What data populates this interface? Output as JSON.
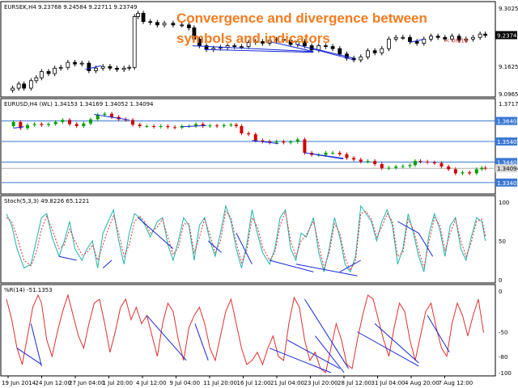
{
  "headline": "Convergence and divergence between symbols and indicators",
  "colors": {
    "background": "#ffffff",
    "frame": "#000000",
    "candle_bull": "#00a000",
    "candle_bear": "#d00000",
    "line_black": "#000000",
    "divergence_line": "#1428d8",
    "hline": "#3a78d4",
    "stoch_main": "#20b2aa",
    "stoch_signal": "#e03030",
    "wpr_line": "#e03030",
    "price_label": "#000000",
    "price_label_text": "#ffffff",
    "hline_label": "#3a78d4",
    "headline": "#f47b20",
    "countdown": "#e03030"
  },
  "panes": {
    "eursek": {
      "label": "EURSEK,H4  9.23768 9.24584 9.22711 9.23749",
      "countdown": "< 0m16",
      "current_price": "9.23749",
      "yticks": [
        "9.3025",
        "9.1625",
        "9.0965"
      ]
    },
    "eurusd": {
      "label": "EURUSD,H4 (WL) 1.34153 1.34169 1.34052 1.34094",
      "top_value": "1.37174",
      "hlines": [
        "1.36400",
        "1.35400",
        "1.34400",
        "1.34094",
        "1.33400"
      ],
      "current_price": "1.34094"
    },
    "stoch": {
      "label": "Stoch(5,3,3) 49.8226 65.1221",
      "yticks": [
        "100",
        "50",
        "0"
      ]
    },
    "wpr": {
      "label": "%R(14) -51.1353",
      "yticks": [
        "0",
        "-50",
        "-80",
        "-100"
      ]
    }
  },
  "xaxis": {
    "labels": [
      "19 Jun 2014",
      "24 Jun 12:00",
      "27 Jun 04:00",
      "1 Jul 20:00",
      "4 Jul 12:00",
      "9 Jul 04:00",
      "11 Jul 20:00",
      "16 Jul 12:00",
      "21 Jul 04:00",
      "23 Jul 20:00",
      "28 Jul 12:00",
      "31 Jul 04:00",
      "4 Aug 20:00",
      "7 Aug 12:00"
    ]
  },
  "chart_data": [
    {
      "type": "candlestick",
      "name": "EURSEK,H4",
      "ylim": [
        9.0965,
        9.3025
      ],
      "points": [
        [
          0,
          9.105
        ],
        [
          7,
          9.11
        ],
        [
          14,
          9.12
        ],
        [
          20,
          9.11
        ],
        [
          28,
          9.128
        ],
        [
          34,
          9.135
        ],
        [
          40,
          9.15
        ],
        [
          48,
          9.145
        ],
        [
          55,
          9.158
        ],
        [
          62,
          9.16
        ],
        [
          70,
          9.172
        ],
        [
          78,
          9.168
        ],
        [
          86,
          9.17
        ],
        [
          94,
          9.152
        ],
        [
          102,
          9.158
        ],
        [
          110,
          9.162
        ],
        [
          118,
          9.158
        ],
        [
          126,
          9.155
        ],
        [
          134,
          9.158
        ],
        [
          140,
          9.16
        ],
        [
          146,
          9.282
        ],
        [
          150,
          9.29
        ],
        [
          156,
          9.27
        ],
        [
          164,
          9.268
        ],
        [
          172,
          9.262
        ],
        [
          180,
          9.266
        ],
        [
          190,
          9.262
        ],
        [
          200,
          9.262
        ],
        [
          208,
          9.255
        ],
        [
          214,
          9.228
        ],
        [
          220,
          9.212
        ],
        [
          228,
          9.203
        ],
        [
          236,
          9.206
        ],
        [
          244,
          9.208
        ],
        [
          252,
          9.212
        ],
        [
          260,
          9.21
        ],
        [
          268,
          9.21
        ],
        [
          276,
          9.22
        ],
        [
          284,
          9.222
        ],
        [
          292,
          9.218
        ],
        [
          300,
          9.225
        ],
        [
          308,
          9.227
        ],
        [
          316,
          9.225
        ],
        [
          324,
          9.215
        ],
        [
          332,
          9.222
        ],
        [
          340,
          9.212
        ],
        [
          348,
          9.202
        ],
        [
          356,
          9.212
        ],
        [
          364,
          9.21
        ],
        [
          372,
          9.205
        ],
        [
          380,
          9.192
        ],
        [
          388,
          9.182
        ],
        [
          396,
          9.178
        ],
        [
          404,
          9.185
        ],
        [
          412,
          9.2
        ],
        [
          420,
          9.195
        ],
        [
          428,
          9.205
        ],
        [
          436,
          9.228
        ],
        [
          444,
          9.232
        ],
        [
          452,
          9.232
        ],
        [
          460,
          9.222
        ],
        [
          468,
          9.218
        ],
        [
          476,
          9.228
        ],
        [
          484,
          9.235
        ],
        [
          492,
          9.232
        ],
        [
          500,
          9.228
        ],
        [
          508,
          9.235
        ],
        [
          516,
          9.225
        ],
        [
          524,
          9.228
        ],
        [
          532,
          9.232
        ],
        [
          540,
          9.24
        ],
        [
          546,
          9.237
        ]
      ]
    },
    {
      "type": "candlestick",
      "name": "EURUSD,H4 (WL)",
      "ylim": [
        1.33,
        1.37174
      ],
      "points": [
        [
          0,
          1.3615
        ],
        [
          8,
          1.3635
        ],
        [
          16,
          1.3605
        ],
        [
          24,
          1.362
        ],
        [
          32,
          1.3625
        ],
        [
          40,
          1.362
        ],
        [
          48,
          1.3625
        ],
        [
          56,
          1.3635
        ],
        [
          64,
          1.3645
        ],
        [
          72,
          1.3625
        ],
        [
          80,
          1.3615
        ],
        [
          88,
          1.3628
        ],
        [
          96,
          1.3648
        ],
        [
          104,
          1.367
        ],
        [
          112,
          1.3675
        ],
        [
          120,
          1.366
        ],
        [
          128,
          1.3648
        ],
        [
          136,
          1.3645
        ],
        [
          144,
          1.3622
        ],
        [
          152,
          1.3615
        ],
        [
          160,
          1.3615
        ],
        [
          168,
          1.3612
        ],
        [
          176,
          1.3615
        ],
        [
          184,
          1.361
        ],
        [
          192,
          1.3608
        ],
        [
          200,
          1.3615
        ],
        [
          208,
          1.3615
        ],
        [
          216,
          1.3625
        ],
        [
          224,
          1.3615
        ],
        [
          232,
          1.3618
        ],
        [
          240,
          1.3615
        ],
        [
          248,
          1.362
        ],
        [
          256,
          1.3622
        ],
        [
          262,
          1.3615
        ],
        [
          268,
          1.358
        ],
        [
          276,
          1.3575
        ],
        [
          284,
          1.3545
        ],
        [
          292,
          1.354
        ],
        [
          300,
          1.3535
        ],
        [
          308,
          1.354
        ],
        [
          316,
          1.3535
        ],
        [
          324,
          1.3538
        ],
        [
          332,
          1.355
        ],
        [
          340,
          1.3485
        ],
        [
          348,
          1.3475
        ],
        [
          356,
          1.3475
        ],
        [
          364,
          1.3485
        ],
        [
          372,
          1.3485
        ],
        [
          380,
          1.3478
        ],
        [
          388,
          1.346
        ],
        [
          396,
          1.3452
        ],
        [
          404,
          1.3442
        ],
        [
          412,
          1.3445
        ],
        [
          420,
          1.343
        ],
        [
          428,
          1.341
        ],
        [
          436,
          1.3412
        ],
        [
          444,
          1.3418
        ],
        [
          452,
          1.342
        ],
        [
          460,
          1.3425
        ],
        [
          466,
          1.3445
        ],
        [
          472,
          1.3442
        ],
        [
          480,
          1.3438
        ],
        [
          488,
          1.3435
        ],
        [
          496,
          1.3418
        ],
        [
          504,
          1.3405
        ],
        [
          512,
          1.3385
        ],
        [
          520,
          1.339
        ],
        [
          528,
          1.3385
        ],
        [
          536,
          1.3405
        ],
        [
          542,
          1.3412
        ],
        [
          546,
          1.3409
        ]
      ]
    },
    {
      "type": "line",
      "name": "Stoch(5,3,3)",
      "ylim": [
        0,
        100
      ],
      "x": [
        0,
        6,
        12,
        20,
        28,
        34,
        40,
        46,
        52,
        60,
        66,
        72,
        78,
        86,
        92,
        98,
        104,
        110,
        116,
        122,
        128,
        134,
        140,
        146,
        152,
        158,
        164,
        172,
        178,
        184,
        190,
        196,
        202,
        208,
        214,
        220,
        226,
        232,
        238,
        244,
        250,
        256,
        262,
        268,
        274,
        280,
        286,
        292,
        300,
        306,
        312,
        318,
        324,
        330,
        336,
        342,
        350,
        356,
        362,
        368,
        374,
        380,
        386,
        392,
        398,
        404,
        410,
        416,
        422,
        428,
        434,
        440,
        446,
        452,
        458,
        464,
        470,
        476,
        482,
        488,
        494,
        500,
        506,
        512,
        518,
        524,
        530,
        536,
        542,
        546
      ],
      "series": [
        {
          "name": "main",
          "values": [
            85,
            70,
            40,
            15,
            20,
            50,
            80,
            85,
            55,
            30,
            50,
            75,
            40,
            25,
            40,
            50,
            15,
            60,
            75,
            90,
            50,
            20,
            60,
            85,
            80,
            70,
            55,
            75,
            80,
            45,
            25,
            50,
            80,
            70,
            25,
            70,
            80,
            50,
            30,
            60,
            95,
            75,
            40,
            15,
            45,
            90,
            60,
            35,
            20,
            40,
            80,
            90,
            40,
            25,
            60,
            55,
            80,
            35,
            10,
            40,
            80,
            55,
            20,
            10,
            30,
            95,
            85,
            75,
            50,
            75,
            90,
            70,
            20,
            40,
            85,
            60,
            30,
            10,
            60,
            85,
            65,
            30,
            70,
            80,
            40,
            25,
            55,
            80,
            75,
            50
          ]
        },
        {
          "name": "signal",
          "values": [
            80,
            75,
            55,
            25,
            18,
            35,
            65,
            82,
            65,
            40,
            45,
            65,
            50,
            32,
            35,
            45,
            25,
            45,
            65,
            82,
            60,
            30,
            45,
            75,
            82,
            74,
            60,
            68,
            78,
            55,
            32,
            42,
            72,
            72,
            35,
            55,
            78,
            58,
            35,
            50,
            88,
            80,
            48,
            22,
            38,
            80,
            68,
            42,
            25,
            35,
            70,
            88,
            50,
            30,
            50,
            58,
            75,
            45,
            15,
            35,
            72,
            60,
            28,
            12,
            25,
            85,
            88,
            78,
            55,
            68,
            85,
            75,
            30,
            35,
            78,
            65,
            38,
            15,
            50,
            80,
            70,
            38,
            60,
            78,
            50,
            30,
            48,
            75,
            78,
            56
          ]
        }
      ]
    },
    {
      "type": "line",
      "name": "%R(14)",
      "ylim": [
        -100,
        0
      ],
      "x": [
        0,
        6,
        12,
        18,
        24,
        30,
        36,
        40,
        46,
        52,
        58,
        64,
        70,
        76,
        82,
        88,
        94,
        100,
        106,
        112,
        118,
        124,
        130,
        136,
        142,
        148,
        154,
        160,
        166,
        172,
        178,
        184,
        190,
        196,
        202,
        208,
        214,
        220,
        226,
        232,
        238,
        244,
        250,
        256,
        262,
        268,
        274,
        280,
        286,
        292,
        298,
        304,
        310,
        316,
        322,
        328,
        334,
        340,
        346,
        352,
        358,
        364,
        370,
        376,
        382,
        388,
        394,
        400,
        406,
        412,
        418,
        424,
        430,
        436,
        442,
        448,
        454,
        460,
        466,
        472,
        478,
        484,
        490,
        496,
        502,
        508,
        514,
        520,
        526,
        532,
        538,
        544
      ],
      "series": [
        {
          "name": "%R",
          "values": [
            -10,
            -35,
            -70,
            -90,
            -55,
            -20,
            -5,
            -15,
            -60,
            -80,
            -50,
            -25,
            -5,
            -30,
            -55,
            -70,
            -40,
            -15,
            -10,
            -40,
            -75,
            -50,
            -20,
            -10,
            -35,
            -20,
            -40,
            -30,
            -55,
            -80,
            -40,
            -15,
            -25,
            -60,
            -85,
            -45,
            -30,
            -20,
            -40,
            -70,
            -85,
            -55,
            -25,
            -10,
            -40,
            -70,
            -90,
            -85,
            -75,
            -90,
            -70,
            -55,
            -80,
            -85,
            -40,
            -8,
            -20,
            -60,
            -85,
            -75,
            -95,
            -100,
            -70,
            -40,
            -60,
            -90,
            -95,
            -60,
            -30,
            -5,
            -10,
            -35,
            -60,
            -80,
            -45,
            -15,
            -25,
            -60,
            -85,
            -55,
            -25,
            -15,
            -45,
            -70,
            -80,
            -40,
            -15,
            -30,
            -55,
            -30,
            -10,
            -51
          ]
        }
      ]
    }
  ]
}
